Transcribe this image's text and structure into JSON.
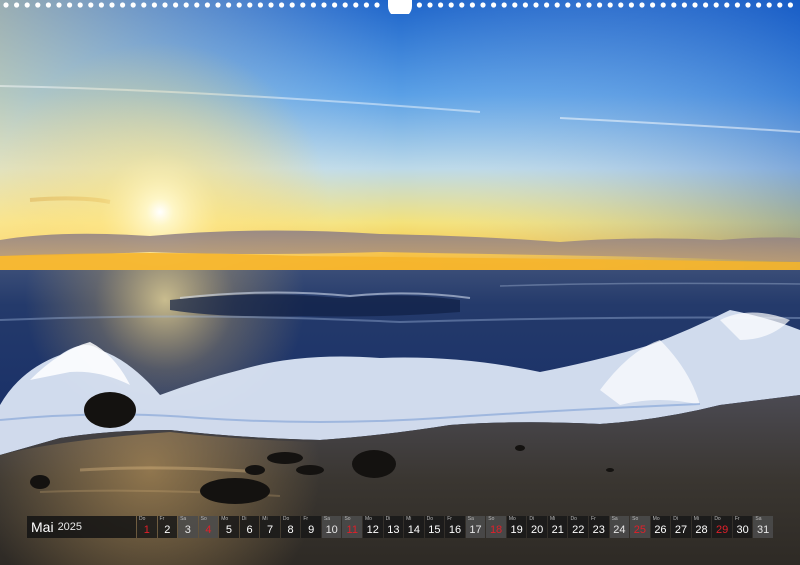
{
  "colors": {
    "sky_top": "#1c63c9",
    "horizon": "#f7b12a",
    "sea": "#1c2e5c",
    "sand": "#3a3530",
    "holiday_red": "#e0202a"
  },
  "calendar": {
    "month": "Mai",
    "year": "2025",
    "days": [
      {
        "wd": "Do",
        "day": "1",
        "weekend": false,
        "holiday": true
      },
      {
        "wd": "Fr",
        "day": "2",
        "weekend": false,
        "holiday": false
      },
      {
        "wd": "Sa",
        "day": "3",
        "weekend": true,
        "holiday": false
      },
      {
        "wd": "So",
        "day": "4",
        "weekend": true,
        "holiday": true
      },
      {
        "wd": "Mo",
        "day": "5",
        "weekend": false,
        "holiday": false
      },
      {
        "wd": "Di",
        "day": "6",
        "weekend": false,
        "holiday": false
      },
      {
        "wd": "Mi",
        "day": "7",
        "weekend": false,
        "holiday": false
      },
      {
        "wd": "Do",
        "day": "8",
        "weekend": false,
        "holiday": false
      },
      {
        "wd": "Fr",
        "day": "9",
        "weekend": false,
        "holiday": false
      },
      {
        "wd": "Sa",
        "day": "10",
        "weekend": true,
        "holiday": false
      },
      {
        "wd": "So",
        "day": "11",
        "weekend": true,
        "holiday": true
      },
      {
        "wd": "Mo",
        "day": "12",
        "weekend": false,
        "holiday": false
      },
      {
        "wd": "Di",
        "day": "13",
        "weekend": false,
        "holiday": false
      },
      {
        "wd": "Mi",
        "day": "14",
        "weekend": false,
        "holiday": false
      },
      {
        "wd": "Do",
        "day": "15",
        "weekend": false,
        "holiday": false
      },
      {
        "wd": "Fr",
        "day": "16",
        "weekend": false,
        "holiday": false
      },
      {
        "wd": "Sa",
        "day": "17",
        "weekend": true,
        "holiday": false
      },
      {
        "wd": "So",
        "day": "18",
        "weekend": true,
        "holiday": true
      },
      {
        "wd": "Mo",
        "day": "19",
        "weekend": false,
        "holiday": false
      },
      {
        "wd": "Di",
        "day": "20",
        "weekend": false,
        "holiday": false
      },
      {
        "wd": "Mi",
        "day": "21",
        "weekend": false,
        "holiday": false
      },
      {
        "wd": "Do",
        "day": "22",
        "weekend": false,
        "holiday": false
      },
      {
        "wd": "Fr",
        "day": "23",
        "weekend": false,
        "holiday": false
      },
      {
        "wd": "Sa",
        "day": "24",
        "weekend": true,
        "holiday": false
      },
      {
        "wd": "So",
        "day": "25",
        "weekend": true,
        "holiday": true
      },
      {
        "wd": "Mo",
        "day": "26",
        "weekend": false,
        "holiday": false
      },
      {
        "wd": "Di",
        "day": "27",
        "weekend": false,
        "holiday": false
      },
      {
        "wd": "Mi",
        "day": "28",
        "weekend": false,
        "holiday": false
      },
      {
        "wd": "Do",
        "day": "29",
        "weekend": false,
        "holiday": true
      },
      {
        "wd": "Fr",
        "day": "30",
        "weekend": false,
        "holiday": false
      },
      {
        "wd": "Sa",
        "day": "31",
        "weekend": true,
        "holiday": false
      }
    ]
  }
}
